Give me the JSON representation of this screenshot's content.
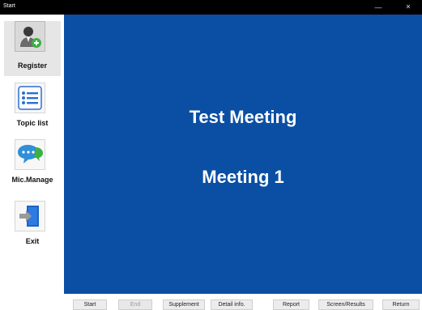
{
  "window": {
    "title": "Start",
    "minimize_glyph": "—",
    "close_glyph": "✕"
  },
  "sidebar": {
    "items": [
      {
        "label": "Register",
        "icon": "person-add-icon",
        "active": true
      },
      {
        "label": "Topic list",
        "icon": "list-icon",
        "active": false
      },
      {
        "label": "Mic.Manage",
        "icon": "chat-bubbles-icon",
        "active": false
      },
      {
        "label": "Exit",
        "icon": "exit-door-icon",
        "active": false
      }
    ]
  },
  "main": {
    "title": "Test Meeting",
    "meeting": "Meeting 1",
    "background": "#0a4fa3"
  },
  "toolbar": {
    "buttons": [
      {
        "label": "Start",
        "enabled": true
      },
      {
        "label": "End",
        "enabled": false
      },
      {
        "label": "Supplement",
        "enabled": true
      },
      {
        "label": "Detail info.",
        "enabled": true
      },
      {
        "label": "Report",
        "enabled": true
      },
      {
        "label": "Screen/Results",
        "enabled": true
      },
      {
        "label": "Return",
        "enabled": true
      }
    ]
  }
}
